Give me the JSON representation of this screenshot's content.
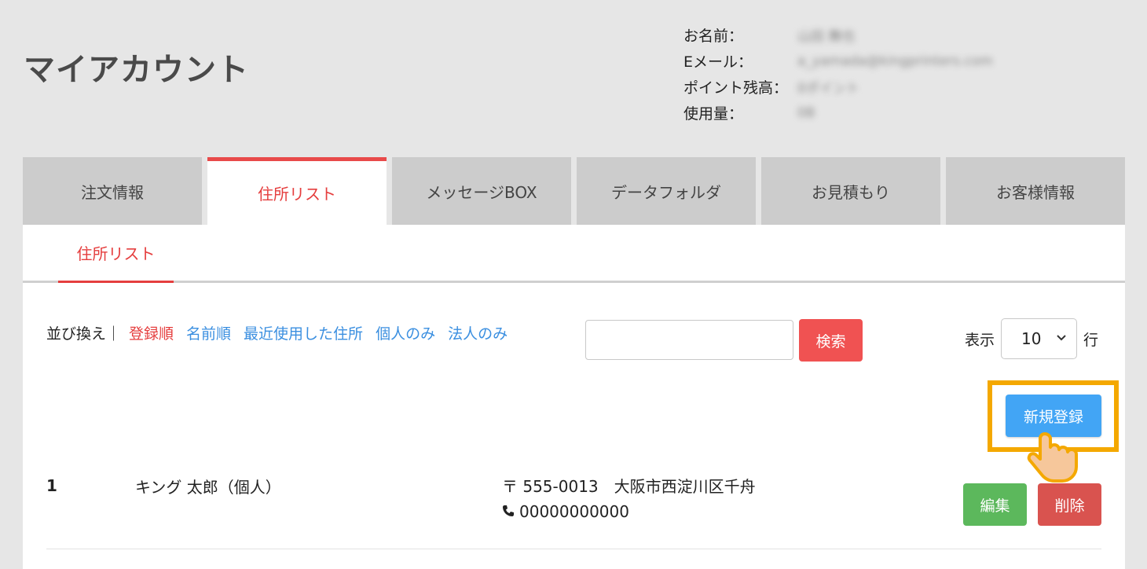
{
  "header": {
    "title": "マイアカウント",
    "user_info": [
      {
        "label": "お名前：",
        "value": "山田 舞也"
      },
      {
        "label": "Eメール：",
        "value": "a_yamada@kingprinters.com"
      },
      {
        "label": "ポイント残高：",
        "value": "0ポイント"
      },
      {
        "label": "使用量：",
        "value": "0B"
      }
    ]
  },
  "tabs": [
    {
      "label": "注文情報",
      "active": false
    },
    {
      "label": "住所リスト",
      "active": true
    },
    {
      "label": "メッセージBOX",
      "active": false
    },
    {
      "label": "データフォルダ",
      "active": false
    },
    {
      "label": "お見積もり",
      "active": false
    },
    {
      "label": "お客様情報",
      "active": false
    }
  ],
  "subtab": {
    "label": "住所リスト"
  },
  "sort": {
    "label": "並び換え｜",
    "options": [
      "登録順",
      "名前順",
      "最近使用した住所",
      "個人のみ",
      "法人のみ"
    ],
    "active_index": 0
  },
  "search": {
    "value": "",
    "button_label": "検索"
  },
  "display": {
    "prefix": "表示",
    "value": "10",
    "suffix": "行"
  },
  "new_button_label": "新規登録",
  "addresses": [
    {
      "number": "1",
      "name": "キング 太郎（個人）",
      "postal": "〒 555-0013　大阪市西淀川区千舟",
      "phone": "00000000000",
      "edit_label": "編集",
      "delete_label": "削除"
    }
  ],
  "colors": {
    "accent_red": "#e53e3e",
    "link_blue": "#3b8fe0",
    "new_button": "#42a5f5",
    "edit_button": "#5cb85c",
    "delete_button": "#d9534f",
    "highlight": "#f4a800"
  },
  "icons": {
    "phone": "phone-icon",
    "chevron": "chevron-down-icon",
    "pointer": "pointer-hand-icon"
  }
}
